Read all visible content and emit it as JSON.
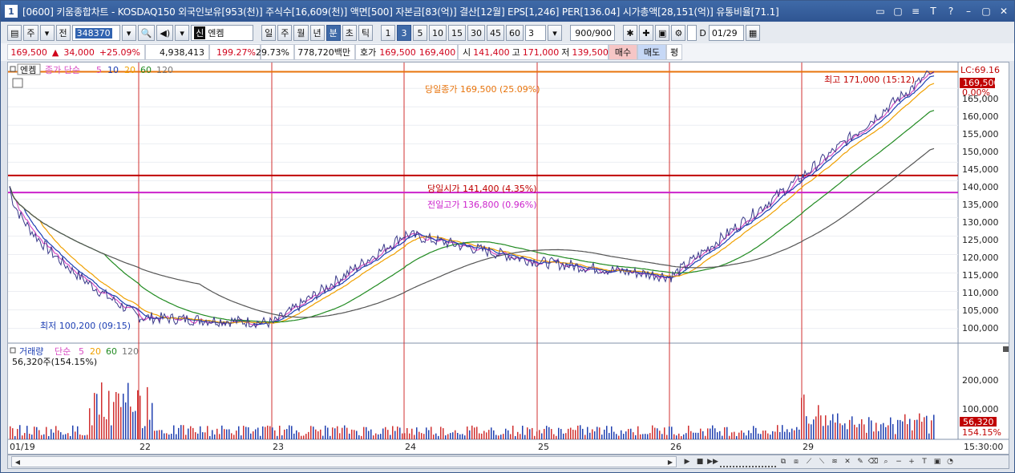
{
  "window": {
    "app_number": "1",
    "title": "[0600] 키움종합차트 - KOSDAQ150 외국인보유[953(천)] 주식수[16,609(천)] 액면[500] 자본금[83(억)] 결산[12월] EPS[1,246] PER[136.04] 시가총액[28,151(억)] 유통비율[71.1]",
    "controls": [
      "▭",
      "▢",
      "≡",
      "T",
      "?",
      "–",
      "▢",
      "✕"
    ]
  },
  "toolbar": {
    "type_a": "주",
    "type_b": "전",
    "code": "348370",
    "stock_name_prefix": "신",
    "stock_name": "엔켐",
    "periods": [
      "일",
      "주",
      "월",
      "년",
      "분",
      "초",
      "틱"
    ],
    "selected_period": "분",
    "minutes": [
      "1",
      "3",
      "5",
      "10",
      "15",
      "30",
      "45",
      "60"
    ],
    "selected_minute": "3",
    "interval_value": "3",
    "count": "900/900",
    "date": "01/29"
  },
  "quote_bar": {
    "price": "169,500",
    "change_arrow": "▲",
    "change": "34,000",
    "change_pct": "+25.09%",
    "volume": "4,938,413",
    "vol_ratio": "199.27%",
    "turnover": "29.73%",
    "amount": "778,720백만",
    "ask_label": "호가",
    "ask": "169,500",
    "bid": "169,400",
    "open_label": "시",
    "open": "141,400",
    "high_label": "고",
    "high": "171,000",
    "low_label": "저",
    "low": "139,500",
    "buy": "매수",
    "sell": "매도",
    "eval": "평"
  },
  "price_panel": {
    "legend_name": "엔켐",
    "legend_ma": "종가 단순",
    "ma_periods": [
      "5",
      "10",
      "20",
      "60",
      "120"
    ],
    "ma_colors": [
      "#d94dc4",
      "#1d3fb3",
      "#f0a000",
      "#228b22",
      "#555555"
    ],
    "axis_ticks": [
      "165,000",
      "160,000",
      "155,000",
      "150,000",
      "145,000",
      "140,000",
      "135,000",
      "130,000",
      "125,000",
      "120,000",
      "115,000",
      "110,000",
      "105,000",
      "100,000"
    ],
    "lc_label": "LC:69.16",
    "current_price_box": "169,500",
    "pct_label": "0.00%",
    "high_marker": "최고 171,000 (15:12)",
    "low_marker": "최저 100,200 (09:15)",
    "close_line_label": "당일종가 169,500 (25.09%)",
    "open_line_label": "당일시가 141,400 (4.35%)",
    "prevhigh_line_label": "전일고가 136,800 (0.96%)",
    "line_colors": {
      "close": "#e8740c",
      "open": "#c00000",
      "prevhigh": "#cc22cc"
    }
  },
  "volume_panel": {
    "legend_name": "거래량",
    "legend_ma": "단순",
    "ma_periods": [
      "5",
      "20",
      "60",
      "120"
    ],
    "info": "56,320주(154.15%)",
    "axis_ticks": [
      "200,000",
      "100,000"
    ],
    "current_box": "56,320",
    "current_pct": "154.15%"
  },
  "x_axis": {
    "labels": [
      "01/19",
      "22",
      "23",
      "24",
      "25",
      "26",
      "29"
    ],
    "time_label": "15:30:00"
  },
  "chart_data": {
    "type": "line",
    "title": "",
    "xlabel": "",
    "ylabel": "",
    "ylim": [
      96000,
      172000
    ],
    "x": [
      "01/19",
      "22",
      "23",
      "24",
      "25",
      "26",
      "29",
      "15:30"
    ],
    "series": [
      {
        "name": "종가",
        "values": [
          138500,
          103000,
          101500,
          125500,
          118000,
          114000,
          141400,
          169500
        ]
      }
    ],
    "hlines": [
      169500,
      141400,
      136800
    ]
  }
}
